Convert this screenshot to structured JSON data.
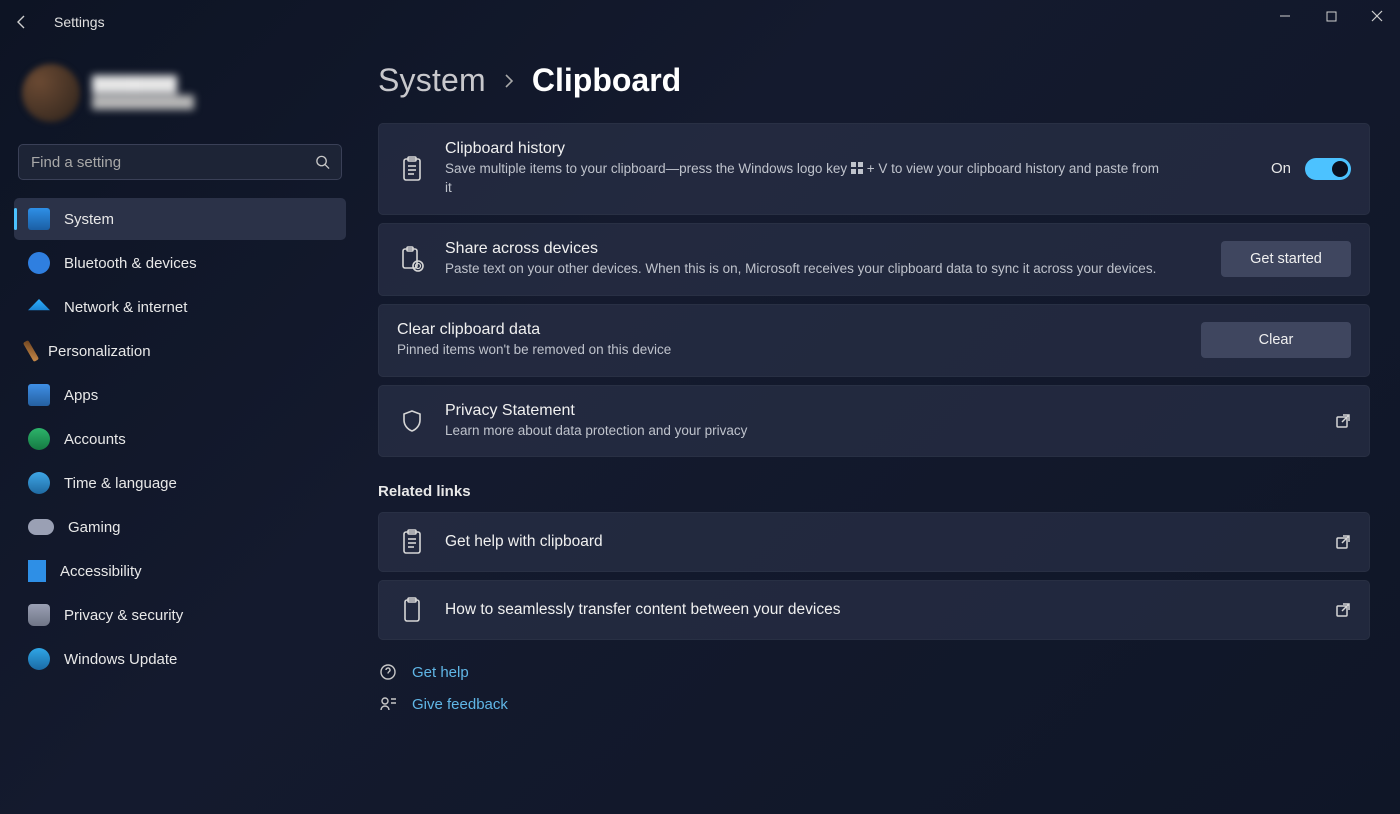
{
  "app": {
    "title": "Settings"
  },
  "search": {
    "placeholder": "Find a setting"
  },
  "nav": {
    "items": [
      {
        "label": "System"
      },
      {
        "label": "Bluetooth & devices"
      },
      {
        "label": "Network & internet"
      },
      {
        "label": "Personalization"
      },
      {
        "label": "Apps"
      },
      {
        "label": "Accounts"
      },
      {
        "label": "Time & language"
      },
      {
        "label": "Gaming"
      },
      {
        "label": "Accessibility"
      },
      {
        "label": "Privacy & security"
      },
      {
        "label": "Windows Update"
      }
    ]
  },
  "breadcrumb": {
    "parent": "System",
    "current": "Clipboard"
  },
  "cards": {
    "history": {
      "title": "Clipboard history",
      "desc_pre": "Save multiple items to your clipboard—press the Windows logo key ",
      "desc_post": " + V to view your clipboard history and paste from it",
      "toggle_label": "On",
      "toggle_state": "on"
    },
    "share": {
      "title": "Share across devices",
      "desc": "Paste text on your other devices. When this is on, Microsoft receives your clipboard data to sync it across your devices.",
      "button": "Get started"
    },
    "clear": {
      "title": "Clear clipboard data",
      "desc": "Pinned items won't be removed on this device",
      "button": "Clear"
    },
    "privacy": {
      "title": "Privacy Statement",
      "desc": "Learn more about data protection and your privacy"
    }
  },
  "related": {
    "heading": "Related links",
    "items": [
      {
        "label": "Get help with clipboard"
      },
      {
        "label": "How to seamlessly transfer content between your devices"
      }
    ]
  },
  "footer": {
    "help": "Get help",
    "feedback": "Give feedback"
  }
}
